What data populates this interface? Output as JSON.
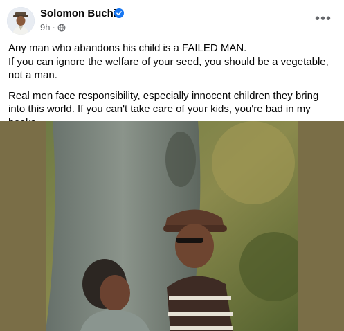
{
  "post": {
    "author": "Solomon Buchi",
    "time": "9h",
    "dot": "·",
    "more_label": "•••",
    "paragraph1": "Any man who abandons his child is a FAILED MAN.\nIf you can ignore the welfare of your seed, you should be a vegetable, not a man.",
    "paragraph1_line1": "Any man who abandons his child is a FAILED MAN.",
    "paragraph1_line2": "If you can ignore the welfare of your seed, you should be a vegetable, not a man.",
    "paragraph2": "Real men face responsibility, especially innocent children they bring into this world. If you can't take care of your kids, you're bad in my books."
  },
  "colors": {
    "verified": "#1877f2",
    "meta_text": "#65676b",
    "photo_backdrop": "#7a6e47"
  },
  "icons": {
    "verified": "verified-badge-icon",
    "audience": "globe-icon",
    "more": "more-options-icon"
  }
}
